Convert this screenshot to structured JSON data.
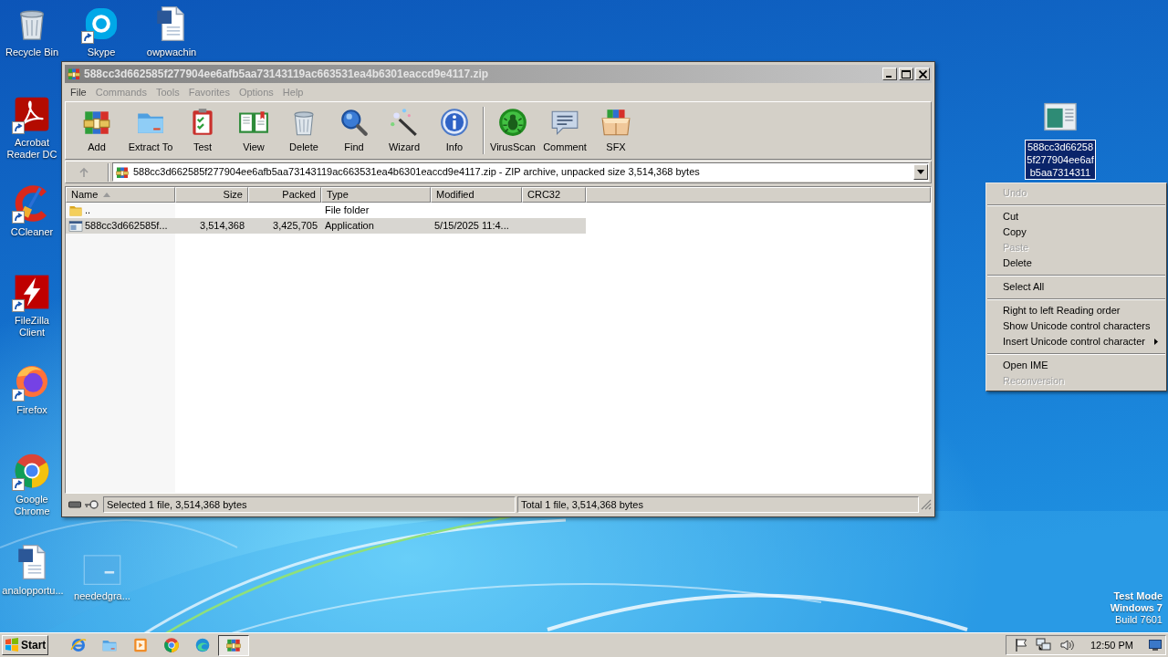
{
  "desktop_icons": [
    {
      "label": "Recycle Bin",
      "kind": "recycle",
      "shortcut": false,
      "selected": false
    },
    {
      "label": "Skype",
      "kind": "skype",
      "shortcut": true,
      "selected": false
    },
    {
      "label": "owpwachin",
      "kind": "word",
      "shortcut": false,
      "selected": false
    },
    {
      "label": "Acrobat Reader DC",
      "kind": "acrobat",
      "shortcut": true,
      "selected": false
    },
    {
      "label": "CCleaner",
      "kind": "ccleaner",
      "shortcut": true,
      "selected": false
    },
    {
      "label": "FileZilla Client",
      "kind": "filezilla",
      "shortcut": true,
      "selected": false
    },
    {
      "label": "Firefox",
      "kind": "firefox",
      "shortcut": true,
      "selected": false
    },
    {
      "label": "Google Chrome",
      "kind": "chrome",
      "shortcut": true,
      "selected": false
    },
    {
      "label": "analopportu...",
      "kind": "word",
      "shortcut": false,
      "selected": false
    },
    {
      "label": "neededgra...",
      "kind": "blank",
      "shortcut": false,
      "selected": false
    },
    {
      "label": "588cc3d662585f277904ee6afb5aa7314311",
      "kind": "app",
      "shortcut": false,
      "selected": true
    }
  ],
  "window": {
    "title": "588cc3d662585f277904ee6afb5aa73143119ac663531ea4b6301eaccd9e4117.zip",
    "active": false,
    "menu": [
      {
        "label": "File",
        "disabled": false
      },
      {
        "label": "Commands",
        "disabled": true
      },
      {
        "label": "Tools",
        "disabled": true
      },
      {
        "label": "Favorites",
        "disabled": true
      },
      {
        "label": "Options",
        "disabled": true
      },
      {
        "label": "Help",
        "disabled": true
      }
    ],
    "toolbar": [
      {
        "kind": "add",
        "label": "Add"
      },
      {
        "kind": "extract",
        "label": "Extract To"
      },
      {
        "kind": "test",
        "label": "Test"
      },
      {
        "kind": "view",
        "label": "View"
      },
      {
        "kind": "delete",
        "label": "Delete"
      },
      {
        "kind": "find",
        "label": "Find"
      },
      {
        "kind": "wizard",
        "label": "Wizard"
      },
      {
        "kind": "info",
        "label": "Info"
      },
      {
        "kind": "separator"
      },
      {
        "kind": "virusscan",
        "label": "VirusScan"
      },
      {
        "kind": "comment",
        "label": "Comment"
      },
      {
        "kind": "sfx",
        "label": "SFX"
      }
    ],
    "address": "588cc3d662585f277904ee6afb5aa73143119ac663531ea4b6301eaccd9e4117.zip - ZIP archive, unpacked size 3,514,368 bytes",
    "columns": [
      {
        "label": "Name",
        "sorted": true
      },
      {
        "label": "Size",
        "sorted": false
      },
      {
        "label": "Packed",
        "sorted": false
      },
      {
        "label": "Type",
        "sorted": false
      },
      {
        "label": "Modified",
        "sorted": false
      },
      {
        "label": "CRC32",
        "sorted": false
      }
    ],
    "rows": [
      {
        "kind": "folder",
        "selected": false,
        "name": "..",
        "type": "File folder"
      },
      {
        "kind": "file",
        "selected": true,
        "name": "588cc3d662585f...",
        "size": "3,514,368",
        "packed": "3,425,705",
        "type": "Application",
        "modified": "5/15/2025 11:4..."
      }
    ],
    "status": [
      "Selected 1 file, 3,514,368 bytes",
      "Total 1 file, 3,514,368 bytes"
    ]
  },
  "context_menu": [
    {
      "kind": "item",
      "label": "Undo",
      "disabled": true,
      "submenu": false
    },
    {
      "kind": "separator"
    },
    {
      "kind": "item",
      "label": "Cut",
      "disabled": false,
      "submenu": false
    },
    {
      "kind": "item",
      "label": "Copy",
      "disabled": false,
      "submenu": false
    },
    {
      "kind": "item",
      "label": "Paste",
      "disabled": true,
      "submenu": false
    },
    {
      "kind": "item",
      "label": "Delete",
      "disabled": false,
      "submenu": false
    },
    {
      "kind": "separator"
    },
    {
      "kind": "item",
      "label": "Select All",
      "disabled": false,
      "submenu": false
    },
    {
      "kind": "separator"
    },
    {
      "kind": "item",
      "label": "Right to left Reading order",
      "disabled": false,
      "submenu": false
    },
    {
      "kind": "item",
      "label": "Show Unicode control characters",
      "disabled": false,
      "submenu": false
    },
    {
      "kind": "item",
      "label": "Insert Unicode control character",
      "disabled": false,
      "submenu": true
    },
    {
      "kind": "separator"
    },
    {
      "kind": "item",
      "label": "Open IME",
      "disabled": false,
      "submenu": false
    },
    {
      "kind": "item",
      "label": "Reconversion",
      "disabled": true,
      "submenu": false
    }
  ],
  "system_watermark": [
    "Test Mode",
    "Windows 7",
    "Build 7601"
  ],
  "taskbar": {
    "start": "Start",
    "apps": [
      {
        "kind": "ie",
        "active": false
      },
      {
        "kind": "explorer",
        "active": false
      },
      {
        "kind": "media",
        "active": false
      },
      {
        "kind": "chrome",
        "active": false
      },
      {
        "kind": "edge",
        "active": false
      },
      {
        "kind": "winrar",
        "active": true
      }
    ],
    "clock": "12:50 PM"
  }
}
